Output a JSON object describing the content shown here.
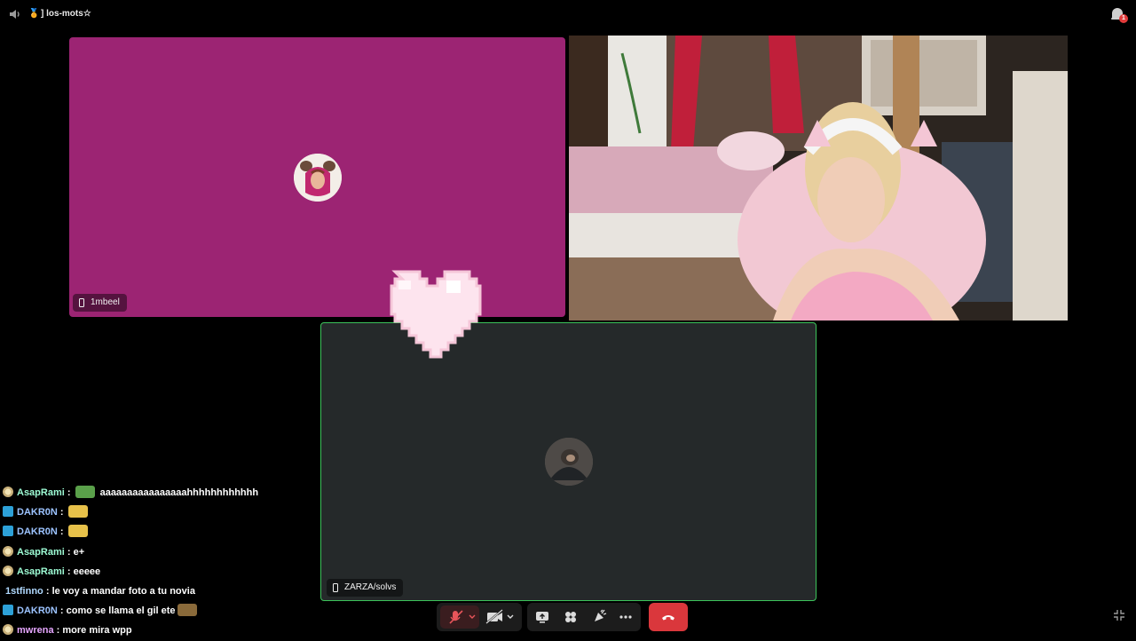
{
  "topbar": {
    "channel_name": "los-mots☆",
    "medal_icon": "🏅",
    "bracket": "]",
    "notification_count": "1"
  },
  "tiles": {
    "pink": {
      "name": "1mbeel"
    },
    "dark": {
      "name": "ZARZA/solvs"
    }
  },
  "chat": [
    {
      "badge": "coin",
      "user": "AsapRami",
      "sep": " : ",
      "message": "aaaaaaaaaaaaaaaahhhhhhhhhhhh",
      "emote": "pepe-emote"
    },
    {
      "badge": "prime",
      "user": "DAKR0N",
      "sep": " : ",
      "message": "",
      "emote": "gift-emote"
    },
    {
      "badge": "prime",
      "user": "DAKR0N",
      "sep": " : ",
      "message": "",
      "emote": "gift-emote"
    },
    {
      "badge": "coin",
      "user": "AsapRami",
      "sep": " : ",
      "message": "e+",
      "emote": ""
    },
    {
      "badge": "coin",
      "user": "AsapRami",
      "sep": " : ",
      "message": "eeeee",
      "emote": ""
    },
    {
      "badge": "",
      "user": "1stfinno",
      "sep": " : ",
      "message": "le voy a mandar foto a tu novia",
      "emote": ""
    },
    {
      "badge": "prime",
      "user": "DAKR0N",
      "sep": " : ",
      "message": "como se llama el gil ete",
      "emote": "car-emote"
    },
    {
      "badge": "coin",
      "user": "mwrena",
      "sep": " : ",
      "message": "more mira wpp",
      "emote": ""
    }
  ],
  "colors": {
    "pink_tile": "#9c2473",
    "dark_tile": "#25292a",
    "speaking_border": "#3cc35a",
    "hangup": "#da373c"
  }
}
